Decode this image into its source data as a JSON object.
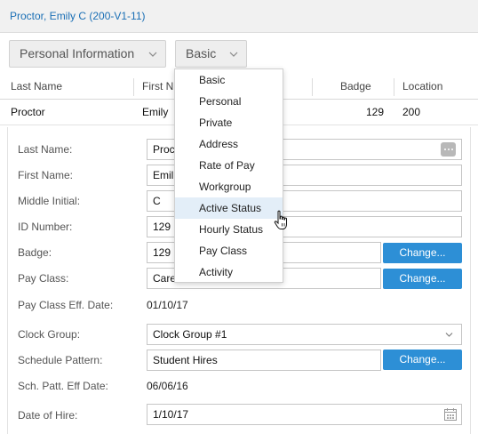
{
  "header": {
    "title": "Proctor, Emily C (200-V1-11)"
  },
  "toolbar": {
    "view_selector": "Personal Information",
    "section_selector": "Basic"
  },
  "grid": {
    "columns": [
      "Last Name",
      "First N",
      "Badge",
      "Location"
    ],
    "row": {
      "last_name": "Proctor",
      "first_name": "Emily",
      "badge": "129",
      "location": "200"
    }
  },
  "form": {
    "last_name": {
      "label": "Last Name:",
      "value": "Proc"
    },
    "first_name": {
      "label": "First Name:",
      "value": "Emil"
    },
    "middle_initial": {
      "label": "Middle Initial:",
      "value": "C"
    },
    "id_number": {
      "label": "ID Number:",
      "value": "129"
    },
    "badge": {
      "label": "Badge:",
      "value": "129",
      "button": "Change..."
    },
    "pay_class": {
      "label": "Pay Class:",
      "value": "Care",
      "button": "Change..."
    },
    "pay_class_eff_date": {
      "label": "Pay Class Eff. Date:",
      "value": "01/10/17"
    },
    "clock_group": {
      "label": "Clock Group:",
      "value": "Clock Group #1"
    },
    "schedule_pattern": {
      "label": "Schedule Pattern:",
      "value": "Student Hires",
      "button": "Change..."
    },
    "sch_patt_eff_date": {
      "label": "Sch. Patt. Eff Date:",
      "value": "06/06/16"
    },
    "date_of_hire": {
      "label": "Date of Hire:",
      "value": "1/10/17"
    }
  },
  "dropdown": {
    "items": [
      "Basic",
      "Personal",
      "Private",
      "Address",
      "Rate of Pay",
      "Workgroup",
      "Active Status",
      "Hourly Status",
      "Pay Class",
      "Activity"
    ],
    "highlighted": "Active Status"
  },
  "colors": {
    "accent": "#2d8fd6",
    "title_link": "#1a6fb5",
    "highlight": "#e3eef8"
  },
  "icons": [
    "chevron-down-icon",
    "ellipsis-icon",
    "calendar-icon",
    "hand-pointer-cursor"
  ]
}
